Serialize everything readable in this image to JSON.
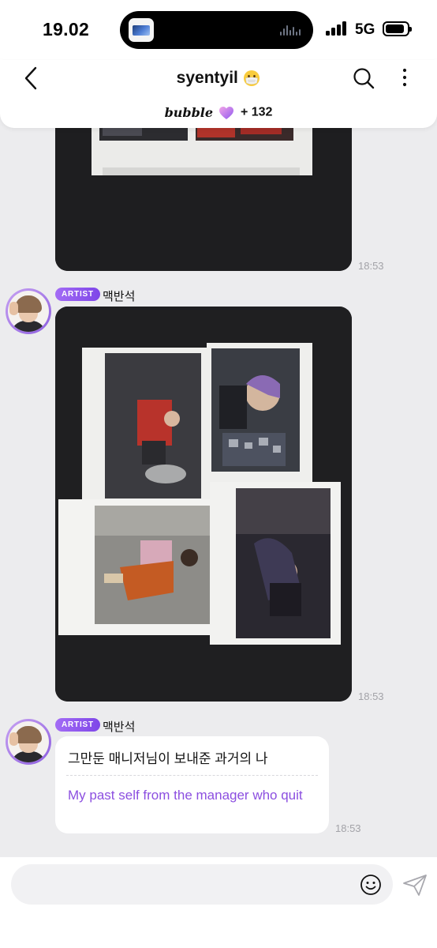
{
  "status_bar": {
    "time": "19.02",
    "network": "5G"
  },
  "header": {
    "title": "syentyil",
    "title_emoji": "masked-face-emoji",
    "brand": "bubble",
    "heart": "purple-heart",
    "subscriber_count": "+ 132"
  },
  "messages": [
    {
      "type": "photo",
      "time": "18:53"
    },
    {
      "type": "photo",
      "badge": "ARTIST",
      "sender": "맥반석",
      "time": "18:53"
    },
    {
      "type": "text",
      "badge": "ARTIST",
      "sender": "맥반석",
      "text_ko": "그만둔 매니저님이 보내준 과거의 나",
      "text_en": "My past self from the manager who quit",
      "time": "18:53"
    }
  ],
  "input": {
    "placeholder": ""
  },
  "colors": {
    "accent": "#8c4fe0",
    "badge": "#9b5df2",
    "background": "#ececee",
    "photo_bg": "#1f1f21"
  },
  "icons": [
    "back-icon",
    "search-icon",
    "more-icon",
    "emoji-icon",
    "send-icon"
  ]
}
